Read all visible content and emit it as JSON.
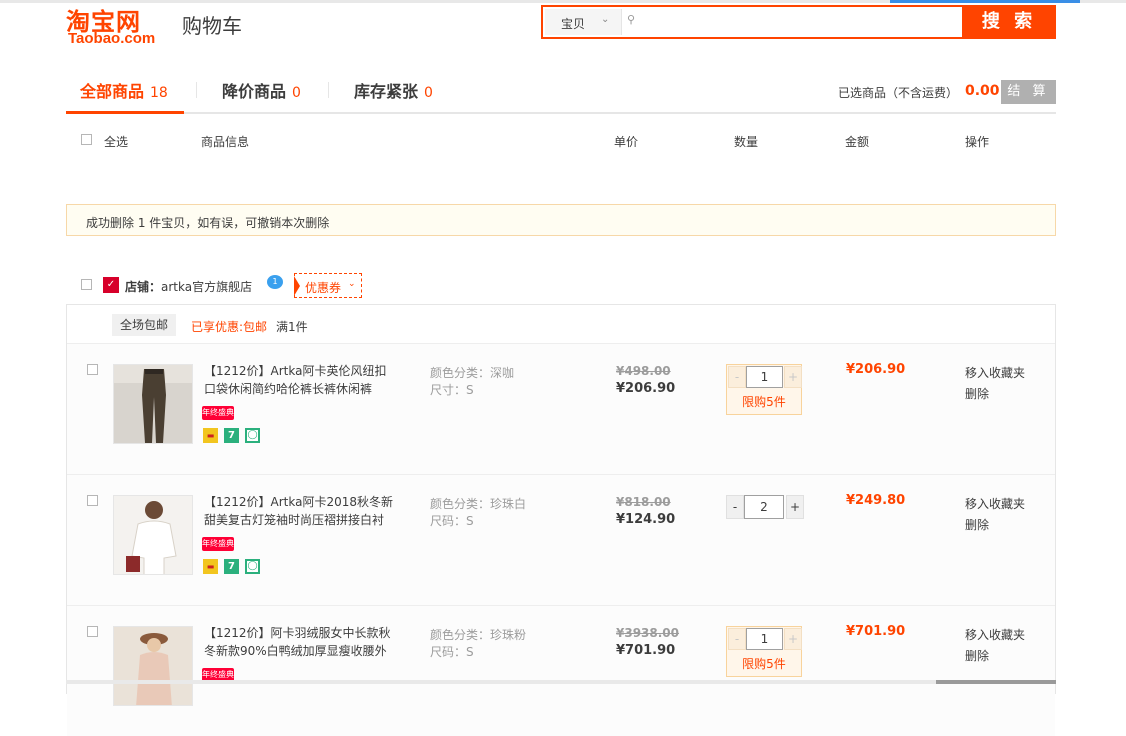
{
  "header": {
    "logo_cn": "淘宝网",
    "logo_en": "Taobao.com",
    "title": "购物车",
    "search_scope": "宝贝",
    "search_placeholder": "",
    "search_button": "搜 索"
  },
  "tabs": [
    {
      "label": "全部商品",
      "count": "18"
    },
    {
      "label": "降价商品",
      "count": "0"
    },
    {
      "label": "库存紧张",
      "count": "0"
    }
  ],
  "summary": {
    "label": "已选商品（不含运费）",
    "total": "0.00",
    "checkout": "结 算"
  },
  "columns": {
    "select_all": "全选",
    "info": "商品信息",
    "unit_price": "单价",
    "quantity": "数量",
    "amount": "金额",
    "action": "操作"
  },
  "notice": "成功删除 1 件宝贝，如有误，可撤销本次删除",
  "shop": {
    "label": "店铺：",
    "name": "artka官方旗舰店",
    "coupon": "优惠券"
  },
  "promo": {
    "tag": "全场包邮",
    "text": "已享优惠:包邮",
    "condition": "满1件"
  },
  "items": [
    {
      "title": "【1212价】Artka阿卡英伦风纽扣口袋休闲简约哈伦裤长裤休闲裤",
      "badge": "年终盛典",
      "sku_color": "颜色分类：深咖",
      "sku_size": "尺寸：S",
      "orig_price": "¥498.00",
      "price": "¥206.90",
      "qty": "1",
      "limit": "限购5件",
      "total": "¥206.90",
      "fav": "移入收藏夹",
      "del": "删除"
    },
    {
      "title": "【1212价】Artka阿卡2018秋冬新甜美复古灯笼袖时尚压褶拼接白衬",
      "badge": "年终盛典",
      "sku_color": "颜色分类：珍珠白",
      "sku_size": "尺码：S",
      "orig_price": "¥818.00",
      "price": "¥124.90",
      "qty": "2",
      "limit": "",
      "total": "¥249.80",
      "fav": "移入收藏夹",
      "del": "删除"
    },
    {
      "title": "【1212价】阿卡羽绒服女中长款秋冬新款90%白鸭绒加厚显瘦收腰外",
      "badge": "年终盛典",
      "sku_color": "颜色分类：珍珠粉",
      "sku_size": "尺码：S",
      "orig_price": "¥3938.00",
      "price": "¥701.90",
      "qty": "1",
      "limit": "限购5件",
      "total": "¥701.90",
      "fav": "移入收藏夹",
      "del": "删除"
    }
  ],
  "colors": {
    "brand": "#ff4400",
    "price": "#ff4400",
    "badge": "#ff0036"
  }
}
